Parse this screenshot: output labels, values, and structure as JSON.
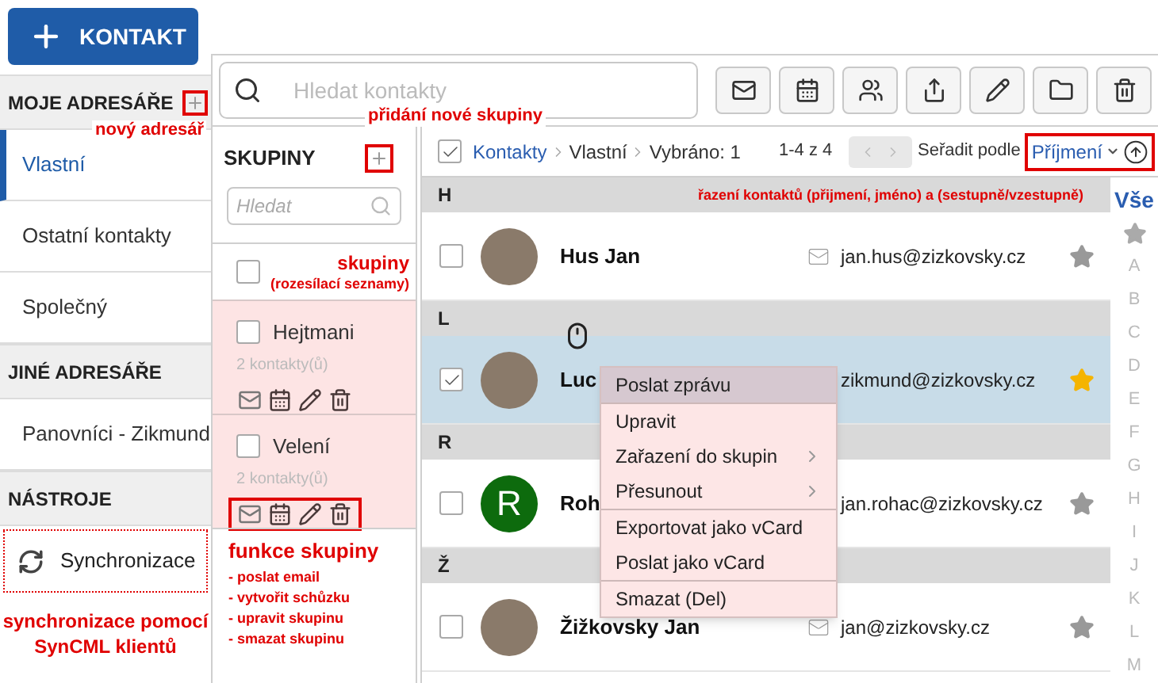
{
  "new_contact_button": "KONTAKT",
  "sidebar": {
    "sections": [
      {
        "title": "MOJE ADRESÁŘE",
        "add_button": true,
        "items": [
          {
            "label": "Vlastní",
            "kind": "addressbook",
            "selected": true
          },
          {
            "label": "Ostatní kontakty",
            "kind": "addressbook",
            "selected": false
          },
          {
            "label": "Společný",
            "kind": "addressbook",
            "selected": false
          }
        ]
      },
      {
        "title": "JINÉ ADRESÁŘE",
        "add_button": false,
        "items": [
          {
            "label": "Panovníci - Zikmund",
            "kind": "addressbook",
            "selected": false
          }
        ]
      },
      {
        "title": "NÁSTROJE",
        "add_button": false,
        "items": [
          {
            "label": "Synchronizace",
            "kind": "tool",
            "selected": false
          }
        ]
      }
    ]
  },
  "search": {
    "placeholder": "Hledat kontakty"
  },
  "groups": {
    "title": "SKUPINY",
    "search_placeholder": "Hledat",
    "all_checked": false,
    "items": [
      {
        "name": "Hejtmani",
        "count": "2 kontakty(ů)",
        "checked": false,
        "highlighted": false
      },
      {
        "name": "Velení",
        "count": "2 kontakty(ů)",
        "checked": false,
        "highlighted": true
      }
    ]
  },
  "list_header": {
    "all_checked": true,
    "breadcrumb": [
      "Kontakty",
      "Vlastní",
      "Vybráno: 1"
    ],
    "range": "1-4 z 4",
    "sort_label": "Seřadit podle",
    "sort_field": "Příjmení"
  },
  "contact_sections": [
    {
      "letter": "H",
      "contacts": [
        {
          "name": "Hus Jan",
          "email": "jan.hus@zizkovsky.cz",
          "selected": false,
          "starred": false,
          "avatar": {
            "kind": "photo"
          }
        }
      ]
    },
    {
      "letter": "L",
      "contacts": [
        {
          "name": "Luc",
          "email": "zikmund@zizkovsky.cz",
          "selected": true,
          "starred": true,
          "avatar": {
            "kind": "photo"
          }
        }
      ]
    },
    {
      "letter": "R",
      "contacts": [
        {
          "name": "Roh",
          "email": "jan.rohac@zizkovsky.cz",
          "selected": false,
          "starred": false,
          "avatar": {
            "kind": "initial",
            "letter": "R",
            "color": "#0d6b0d"
          }
        }
      ]
    },
    {
      "letter": "Ž",
      "contacts": [
        {
          "name": "Žižkovsky Jan",
          "email": "jan@zizkovsky.cz",
          "selected": false,
          "starred": false,
          "avatar": {
            "kind": "photo"
          }
        }
      ]
    }
  ],
  "alphabet": [
    {
      "kind": "label",
      "label": "Vše",
      "selected": true
    },
    {
      "kind": "star",
      "selected": false
    },
    {
      "kind": "label",
      "label": "A",
      "selected": false
    },
    {
      "kind": "label",
      "label": "B",
      "selected": false
    },
    {
      "kind": "label",
      "label": "C",
      "selected": false
    },
    {
      "kind": "label",
      "label": "D",
      "selected": false
    },
    {
      "kind": "label",
      "label": "E",
      "selected": false
    },
    {
      "kind": "label",
      "label": "F",
      "selected": false
    },
    {
      "kind": "label",
      "label": "G",
      "selected": false
    },
    {
      "kind": "label",
      "label": "H",
      "selected": false
    },
    {
      "kind": "label",
      "label": "I",
      "selected": false
    },
    {
      "kind": "label",
      "label": "J",
      "selected": false
    },
    {
      "kind": "label",
      "label": "K",
      "selected": false
    },
    {
      "kind": "label",
      "label": "L",
      "selected": false
    },
    {
      "kind": "label",
      "label": "M",
      "selected": false
    }
  ],
  "context_menu": {
    "groups": [
      [
        {
          "label": "Poslat zprávu",
          "kind": "action",
          "highlighted": true
        }
      ],
      [
        {
          "label": "Upravit",
          "kind": "action",
          "highlighted": false
        },
        {
          "label": "Zařazení do skupin",
          "kind": "submenu",
          "highlighted": false
        },
        {
          "label": "Přesunout",
          "kind": "submenu",
          "highlighted": false
        }
      ],
      [
        {
          "label": "Exportovat jako vCard",
          "kind": "action",
          "highlighted": false
        },
        {
          "label": "Poslat jako vCard",
          "kind": "action",
          "highlighted": false
        }
      ],
      [
        {
          "label": "Smazat (Del)",
          "kind": "action",
          "highlighted": false
        }
      ]
    ]
  },
  "annotations": {
    "new_addressbook": "nový adresář",
    "new_group": "přidání nové skupiny",
    "groups_note": "skupiny",
    "groups_note_sub": "(rozesílací seznamy)",
    "sorting": "řazení kontaktů (přijmení, jméno) a (sestupně/vzestupně)",
    "group_functions": "funkce skupiny",
    "group_function_items": [
      "- poslat email",
      "- vytvořit schůzku",
      "- upravit skupinu",
      "- smazat skupinu"
    ],
    "sync": "synchronizace pomocí SynCML klientů"
  }
}
